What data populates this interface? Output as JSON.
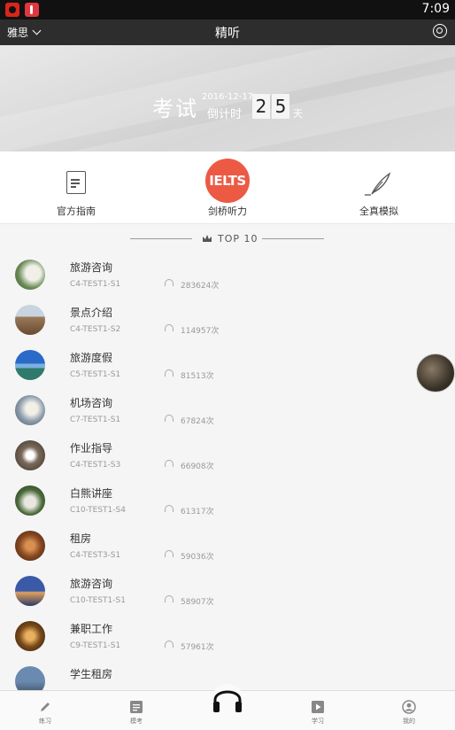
{
  "status_bar": {
    "time": "7:09"
  },
  "header": {
    "exam_selector": "雅思",
    "title": "精听"
  },
  "banner": {
    "exam_label": "考试",
    "date": "2016-12-17",
    "countdown_label": "倒计时",
    "digits": [
      "2",
      "5"
    ],
    "day_unit": "天"
  },
  "categories": [
    {
      "label": "官方指南",
      "icon": "book-icon"
    },
    {
      "label": "剑桥听力",
      "icon": "ielts-icon",
      "badge": "IELTS"
    },
    {
      "label": "全真模拟",
      "icon": "feather-icon"
    }
  ],
  "top_section": {
    "label": "TOP  10"
  },
  "items": [
    {
      "title": "旅游咨询",
      "code": "C4-TEST1-S1",
      "count": "283624次"
    },
    {
      "title": "景点介绍",
      "code": "C4-TEST1-S2",
      "count": "114957次"
    },
    {
      "title": "旅游度假",
      "code": "C5-TEST1-S1",
      "count": "81513次"
    },
    {
      "title": "机场咨询",
      "code": "C7-TEST1-S1",
      "count": "67824次"
    },
    {
      "title": "作业指导",
      "code": "C4-TEST1-S3",
      "count": "66908次"
    },
    {
      "title": "白熊讲座",
      "code": "C10-TEST1-S4",
      "count": "61317次"
    },
    {
      "title": "租房",
      "code": "C4-TEST3-S1",
      "count": "59036次"
    },
    {
      "title": "旅游咨询",
      "code": "C10-TEST1-S1",
      "count": "58907次"
    },
    {
      "title": "兼职工作",
      "code": "C9-TEST1-S1",
      "count": "57961次"
    },
    {
      "title": "学生租房",
      "code": "",
      "count": ""
    }
  ],
  "bottom_nav": [
    {
      "label": "练习",
      "icon": "pencil-icon"
    },
    {
      "label": "模考",
      "icon": "document-icon"
    },
    {
      "label": "",
      "icon": "headphones-icon"
    },
    {
      "label": "学习",
      "icon": "play-icon"
    },
    {
      "label": "我的",
      "icon": "person-icon"
    }
  ],
  "colors": {
    "accent": "#ec5a44",
    "header_bg": "#2d2d2d"
  }
}
